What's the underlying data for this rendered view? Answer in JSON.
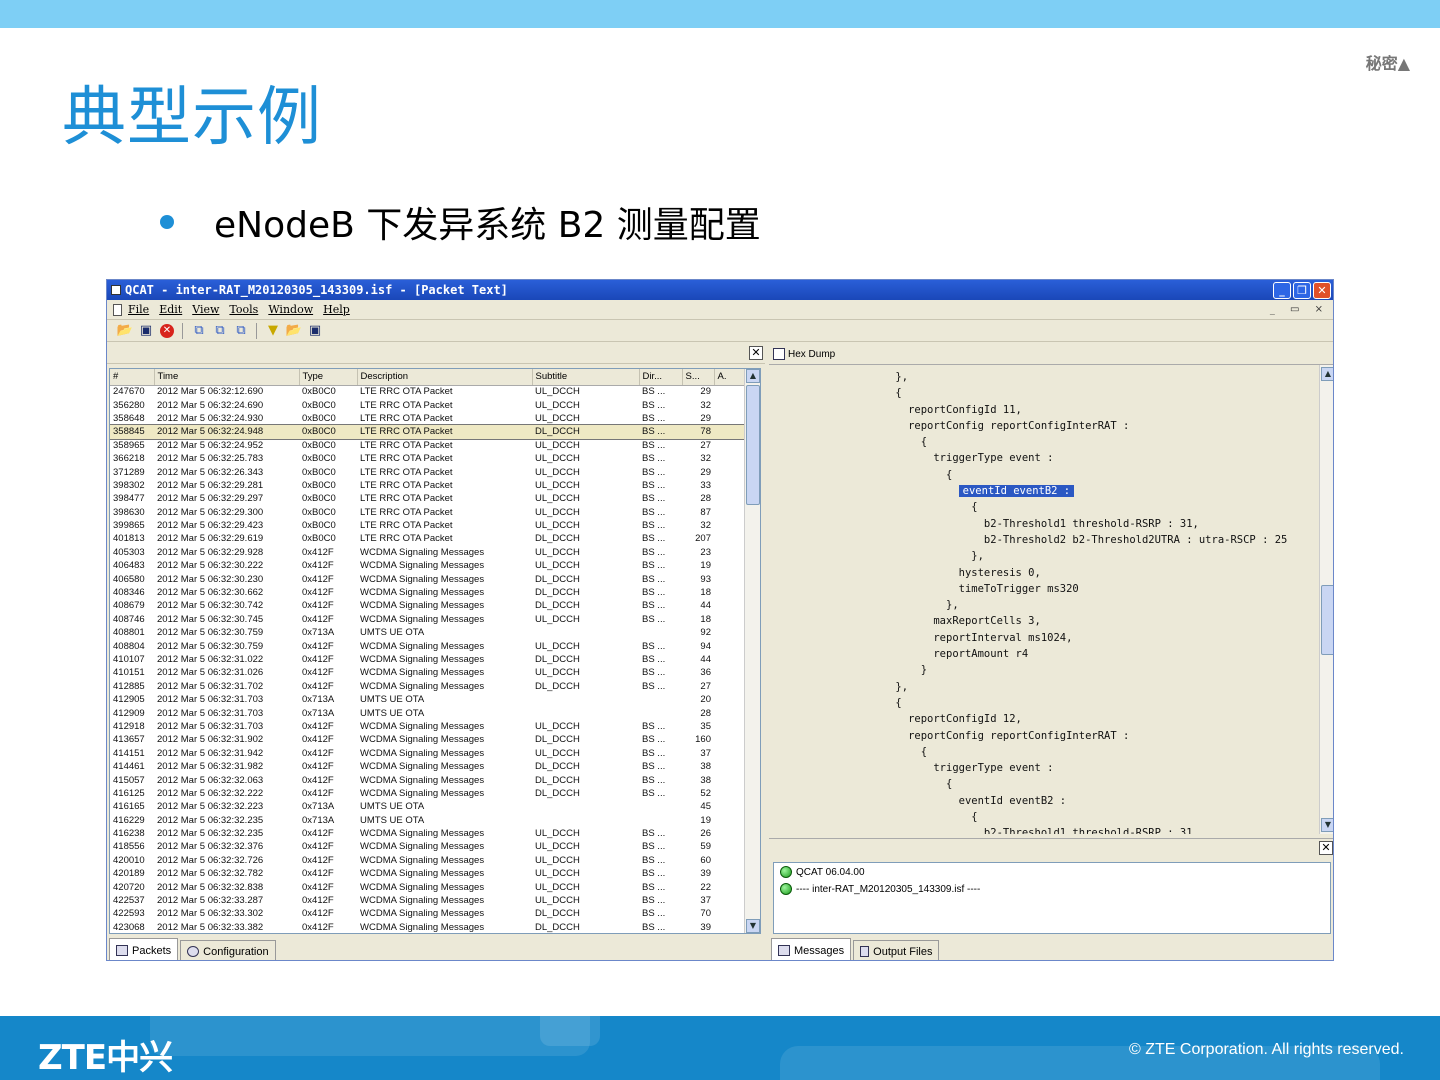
{
  "slide": {
    "classification": "秘密▲",
    "title": "典型示例",
    "bullet": "eNodeB 下发异系统 B2 测量配置",
    "copyright": "© ZTE Corporation. All rights reserved.",
    "logo": "ZTE中兴"
  },
  "window": {
    "title": "QCAT - inter-RAT_M20120305_143309.isf - [Packet Text]",
    "menu": [
      "File",
      "Edit",
      "View",
      "Tools",
      "Window",
      "Help"
    ],
    "mdi_buttons": "_ ▭ ×",
    "close_glyph": "✕"
  },
  "toolbar": {
    "icons": [
      "open-folder-icon",
      "save-icon",
      "stop-icon",
      "filter-packet-icon",
      "filter-packet-icon",
      "filter-packet-icon",
      "filter-funnel-icon",
      "open-folder-icon",
      "save-icon"
    ]
  },
  "packets": {
    "columns": [
      "#",
      "Time",
      "Type",
      "Description",
      "Subtitle",
      "Dir...",
      "S...",
      "A."
    ],
    "rows": [
      [
        "247670",
        "2012 Mar  5 06:32:12.690",
        "0xB0C0",
        "LTE RRC OTA Packet",
        "UL_DCCH",
        "BS ...",
        "29"
      ],
      [
        "356280",
        "2012 Mar  5 06:32:24.690",
        "0xB0C0",
        "LTE RRC OTA Packet",
        "UL_DCCH",
        "BS ...",
        "32"
      ],
      [
        "358648",
        "2012 Mar  5 06:32:24.930",
        "0xB0C0",
        "LTE RRC OTA Packet",
        "UL_DCCH",
        "BS ...",
        "29"
      ],
      [
        "358845",
        "2012 Mar  5 06:32:24.948",
        "0xB0C0",
        "LTE RRC OTA Packet",
        "DL_DCCH",
        "BS ...",
        "78"
      ],
      [
        "358965",
        "2012 Mar  5 06:32:24.952",
        "0xB0C0",
        "LTE RRC OTA Packet",
        "UL_DCCH",
        "BS ...",
        "27"
      ],
      [
        "366218",
        "2012 Mar  5 06:32:25.783",
        "0xB0C0",
        "LTE RRC OTA Packet",
        "UL_DCCH",
        "BS ...",
        "32"
      ],
      [
        "371289",
        "2012 Mar  5 06:32:26.343",
        "0xB0C0",
        "LTE RRC OTA Packet",
        "UL_DCCH",
        "BS ...",
        "29"
      ],
      [
        "398302",
        "2012 Mar  5 06:32:29.281",
        "0xB0C0",
        "LTE RRC OTA Packet",
        "UL_DCCH",
        "BS ...",
        "33"
      ],
      [
        "398477",
        "2012 Mar  5 06:32:29.297",
        "0xB0C0",
        "LTE RRC OTA Packet",
        "UL_DCCH",
        "BS ...",
        "28"
      ],
      [
        "398630",
        "2012 Mar  5 06:32:29.300",
        "0xB0C0",
        "LTE RRC OTA Packet",
        "UL_DCCH",
        "BS ...",
        "87"
      ],
      [
        "399865",
        "2012 Mar  5 06:32:29.423",
        "0xB0C0",
        "LTE RRC OTA Packet",
        "UL_DCCH",
        "BS ...",
        "32"
      ],
      [
        "401813",
        "2012 Mar  5 06:32:29.619",
        "0xB0C0",
        "LTE RRC OTA Packet",
        "DL_DCCH",
        "BS ...",
        "207"
      ],
      [
        "405303",
        "2012 Mar  5 06:32:29.928",
        "0x412F",
        "WCDMA Signaling Messages",
        "UL_DCCH",
        "BS ...",
        "23"
      ],
      [
        "406483",
        "2012 Mar  5 06:32:30.222",
        "0x412F",
        "WCDMA Signaling Messages",
        "UL_DCCH",
        "BS ...",
        "19"
      ],
      [
        "406580",
        "2012 Mar  5 06:32:30.230",
        "0x412F",
        "WCDMA Signaling Messages",
        "DL_DCCH",
        "BS ...",
        "93"
      ],
      [
        "408346",
        "2012 Mar  5 06:32:30.662",
        "0x412F",
        "WCDMA Signaling Messages",
        "DL_DCCH",
        "BS ...",
        "18"
      ],
      [
        "408679",
        "2012 Mar  5 06:32:30.742",
        "0x412F",
        "WCDMA Signaling Messages",
        "DL_DCCH",
        "BS ...",
        "44"
      ],
      [
        "408746",
        "2012 Mar  5 06:32:30.745",
        "0x412F",
        "WCDMA Signaling Messages",
        "UL_DCCH",
        "BS ...",
        "18"
      ],
      [
        "408801",
        "2012 Mar  5 06:32:30.759",
        "0x713A",
        "UMTS UE OTA",
        "",
        "",
        "92"
      ],
      [
        "408804",
        "2012 Mar  5 06:32:30.759",
        "0x412F",
        "WCDMA Signaling Messages",
        "UL_DCCH",
        "BS ...",
        "94"
      ],
      [
        "410107",
        "2012 Mar  5 06:32:31.022",
        "0x412F",
        "WCDMA Signaling Messages",
        "DL_DCCH",
        "BS ...",
        "44"
      ],
      [
        "410151",
        "2012 Mar  5 06:32:31.026",
        "0x412F",
        "WCDMA Signaling Messages",
        "UL_DCCH",
        "BS ...",
        "36"
      ],
      [
        "412885",
        "2012 Mar  5 06:32:31.702",
        "0x412F",
        "WCDMA Signaling Messages",
        "DL_DCCH",
        "BS ...",
        "27"
      ],
      [
        "412905",
        "2012 Mar  5 06:32:31.703",
        "0x713A",
        "UMTS UE OTA",
        "",
        "",
        "20"
      ],
      [
        "412909",
        "2012 Mar  5 06:32:31.703",
        "0x713A",
        "UMTS UE OTA",
        "",
        "",
        "28"
      ],
      [
        "412918",
        "2012 Mar  5 06:32:31.703",
        "0x412F",
        "WCDMA Signaling Messages",
        "UL_DCCH",
        "BS ...",
        "35"
      ],
      [
        "413657",
        "2012 Mar  5 06:32:31.902",
        "0x412F",
        "WCDMA Signaling Messages",
        "DL_DCCH",
        "BS ...",
        "160"
      ],
      [
        "414151",
        "2012 Mar  5 06:32:31.942",
        "0x412F",
        "WCDMA Signaling Messages",
        "UL_DCCH",
        "BS ...",
        "37"
      ],
      [
        "414461",
        "2012 Mar  5 06:32:31.982",
        "0x412F",
        "WCDMA Signaling Messages",
        "DL_DCCH",
        "BS ...",
        "38"
      ],
      [
        "415057",
        "2012 Mar  5 06:32:32.063",
        "0x412F",
        "WCDMA Signaling Messages",
        "DL_DCCH",
        "BS ...",
        "38"
      ],
      [
        "416125",
        "2012 Mar  5 06:32:32.222",
        "0x412F",
        "WCDMA Signaling Messages",
        "DL_DCCH",
        "BS ...",
        "52"
      ],
      [
        "416165",
        "2012 Mar  5 06:32:32.223",
        "0x713A",
        "UMTS UE OTA",
        "",
        "",
        "45"
      ],
      [
        "416229",
        "2012 Mar  5 06:32:32.235",
        "0x713A",
        "UMTS UE OTA",
        "",
        "",
        "19"
      ],
      [
        "416238",
        "2012 Mar  5 06:32:32.235",
        "0x412F",
        "WCDMA Signaling Messages",
        "UL_DCCH",
        "BS ...",
        "26"
      ],
      [
        "418556",
        "2012 Mar  5 06:32:32.376",
        "0x412F",
        "WCDMA Signaling Messages",
        "UL_DCCH",
        "BS ...",
        "59"
      ],
      [
        "420010",
        "2012 Mar  5 06:32:32.726",
        "0x412F",
        "WCDMA Signaling Messages",
        "UL_DCCH",
        "BS ...",
        "60"
      ],
      [
        "420189",
        "2012 Mar  5 06:32:32.782",
        "0x412F",
        "WCDMA Signaling Messages",
        "UL_DCCH",
        "BS ...",
        "39"
      ],
      [
        "420720",
        "2012 Mar  5 06:32:32.838",
        "0x412F",
        "WCDMA Signaling Messages",
        "UL_DCCH",
        "BS ...",
        "22"
      ],
      [
        "422537",
        "2012 Mar  5 06:32:33.287",
        "0x412F",
        "WCDMA Signaling Messages",
        "UL_DCCH",
        "BS ...",
        "37"
      ],
      [
        "422593",
        "2012 Mar  5 06:32:33.302",
        "0x412F",
        "WCDMA Signaling Messages",
        "DL_DCCH",
        "BS ...",
        "70"
      ],
      [
        "423068",
        "2012 Mar  5 06:32:33.382",
        "0x412F",
        "WCDMA Signaling Messages",
        "DL_DCCH",
        "BS ...",
        "39"
      ]
    ],
    "selected_row": 3,
    "tabs": [
      "Packets",
      "Configuration"
    ]
  },
  "packet_text": {
    "hex_dump_label": "Hex Dump",
    "lines": [
      "                    },",
      "                    {",
      "                      reportConfigId 11,",
      "                      reportConfig reportConfigInterRAT :",
      "                        {",
      "                          triggerType event :",
      "                            {",
      "                              eventId eventB2 :",
      "                                {",
      "                                  b2-Threshold1 threshold-RSRP : 31,",
      "                                  b2-Threshold2 b2-Threshold2UTRA : utra-RSCP : 25",
      "                                },",
      "                              hysteresis 0,",
      "                              timeToTrigger ms320",
      "                            },",
      "                          maxReportCells 3,",
      "                          reportInterval ms1024,",
      "                          reportAmount r4",
      "                        }",
      "                    },",
      "                    {",
      "                      reportConfigId 12,",
      "                      reportConfig reportConfigInterRAT :",
      "                        {",
      "                          triggerType event :",
      "                            {",
      "                              eventId eventB2 :",
      "                                {",
      "                                  b2-Threshold1 threshold-RSRP : 31"
    ],
    "highlight_line": 7
  },
  "messages": {
    "lines": [
      "QCAT 06.04.00",
      "---- inter-RAT_M20120305_143309.isf ----"
    ],
    "tabs": [
      "Messages",
      "Output Files"
    ]
  },
  "colors": {
    "brand_blue": "#1e8fd6",
    "footer_blue": "#1587c9",
    "highlight": "#2b58c3"
  }
}
